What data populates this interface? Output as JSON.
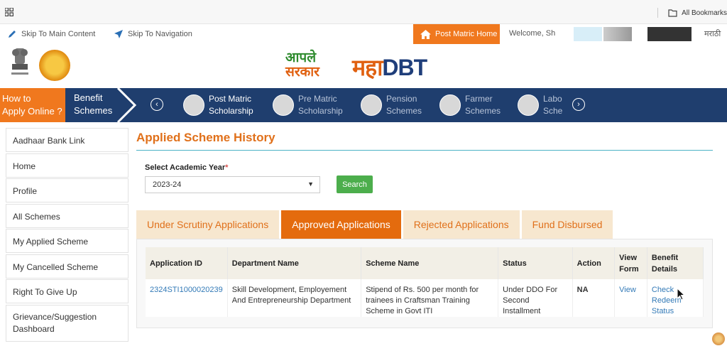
{
  "browser": {
    "bookmarks_label": "All Bookmarks"
  },
  "topbar": {
    "skip_main": "Skip To Main Content",
    "skip_nav": "Skip To Navigation",
    "post_matric_home": "Post Matric Home",
    "welcome": "Welcome, Sh",
    "language": "मराठी"
  },
  "branding": {
    "aaple_line1": "आपले",
    "aaple_line2": "सरकार",
    "maha": "महा",
    "dbt": "DBT"
  },
  "nav": {
    "how_to_line1": "How to",
    "how_to_line2": "Apply Online ?",
    "benefit_line1": "Benefit",
    "benefit_line2": "Schemes",
    "prev": "‹",
    "next": "›",
    "items": [
      {
        "line1": "Post Matric",
        "line2": "Scholarship"
      },
      {
        "line1": "Pre Matric",
        "line2": "Scholarship"
      },
      {
        "line1": "Pension",
        "line2": "Schemes"
      },
      {
        "line1": "Farmer",
        "line2": "Schemes"
      },
      {
        "line1": "Labo",
        "line2": "Sche"
      }
    ]
  },
  "sidebar": {
    "items": [
      "Aadhaar Bank Link",
      "Home",
      "Profile",
      "All Schemes",
      "My Applied Scheme",
      "My Cancelled Scheme",
      "Right To Give Up",
      "Grievance/Suggestion Dashboard"
    ]
  },
  "main": {
    "title": "Applied Scheme History",
    "year_label": "Select Academic Year",
    "year_required": "*",
    "year_value": "2023-24",
    "search_label": "Search",
    "tabs": [
      "Under Scrutiny Applications",
      "Approved Applications",
      "Rejected Applications",
      "Fund Disbursed"
    ],
    "active_tab": "Approved Applications",
    "table": {
      "headers": [
        "Application ID",
        "Department Name",
        "Scheme Name",
        "Status",
        "Action",
        "View Form",
        "Benefit Details"
      ],
      "rows": [
        {
          "app_id": "2324STI1000020239",
          "department": "Skill Development, Employement And Entrepreneurship Department",
          "scheme": "Stipend of Rs. 500 per month for trainees in Craftsman Training Scheme in Govt ITI",
          "status": "Under DDO For Second Installment",
          "action": "NA",
          "view_form": "View",
          "benefit_line1": "Check",
          "benefit_line2": "Redeem",
          "benefit_line3": "Status"
        }
      ]
    }
  },
  "colors": {
    "accent_orange": "#f0781e",
    "nav_blue": "#1f3e6e",
    "search_green": "#4cae4c",
    "link_blue": "#337ab7",
    "divider_teal": "#4cb2c5"
  }
}
